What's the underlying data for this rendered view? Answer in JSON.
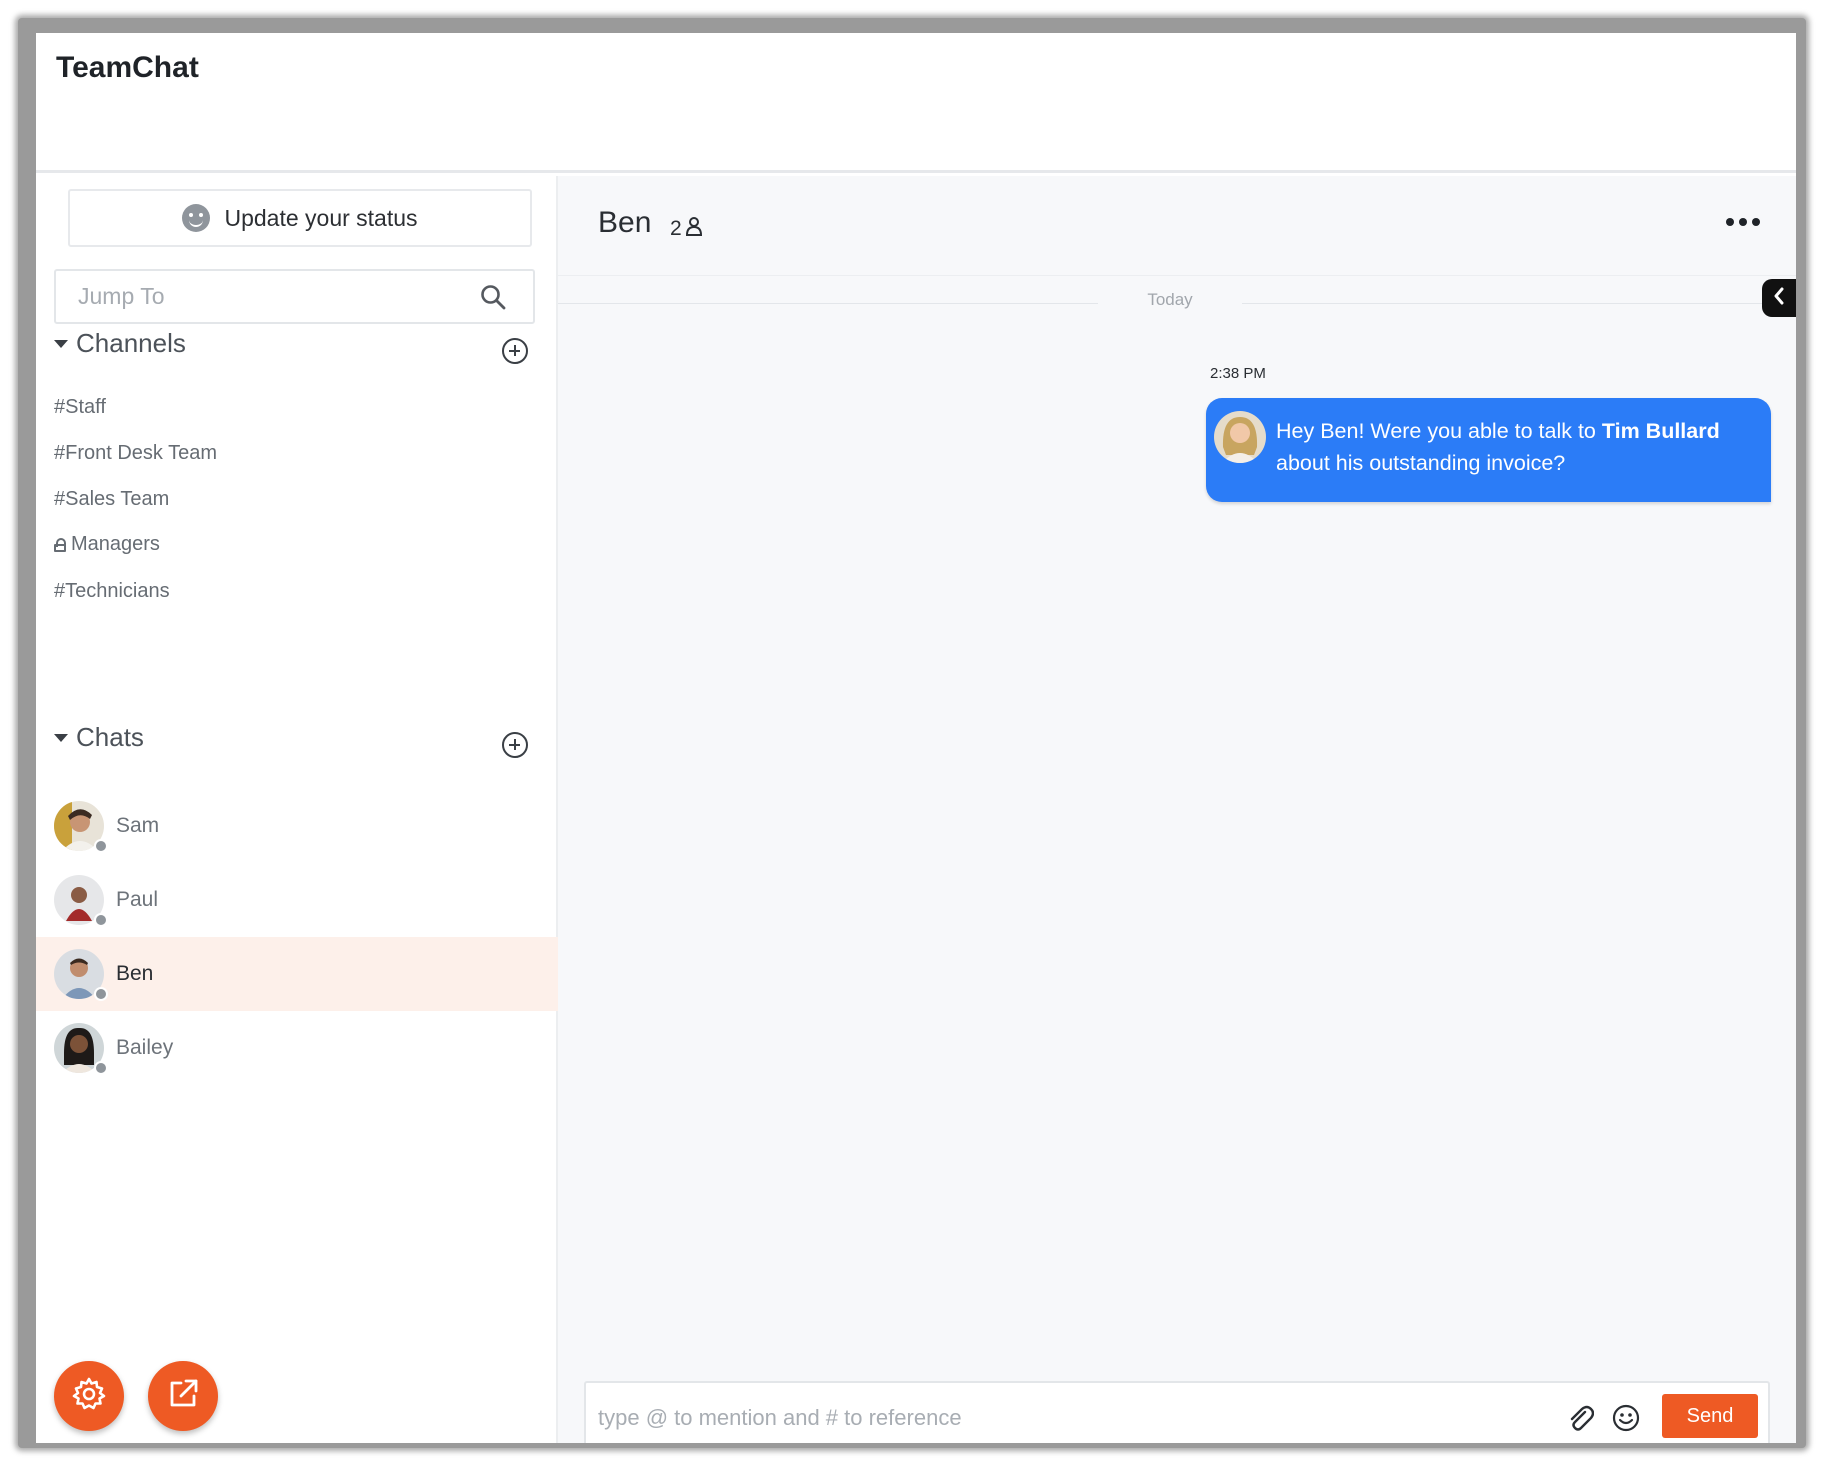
{
  "app": {
    "title": "TeamChat"
  },
  "status": {
    "label": "Update your status"
  },
  "jump": {
    "placeholder": "Jump To"
  },
  "channels": {
    "header": "Channels",
    "items": [
      {
        "label": "#Staff",
        "private": false
      },
      {
        "label": "#Front Desk Team",
        "private": false
      },
      {
        "label": "#Sales Team",
        "private": false
      },
      {
        "label": "Managers",
        "private": true
      },
      {
        "label": "#Technicians",
        "private": false
      }
    ]
  },
  "chats": {
    "header": "Chats",
    "items": [
      {
        "name": "Sam",
        "active": false
      },
      {
        "name": "Paul",
        "active": false
      },
      {
        "name": "Ben",
        "active": true
      },
      {
        "name": "Bailey",
        "active": false
      }
    ]
  },
  "conversation": {
    "title": "Ben",
    "member_count": "2",
    "date_divider": "Today",
    "messages": [
      {
        "time": "2:38 PM",
        "text_before": "Hey Ben! Were you able to talk to ",
        "mention": "Tim Bullard",
        "text_after": " about his outstanding invoice?"
      }
    ]
  },
  "composer": {
    "placeholder": "type @ to mention and # to reference",
    "send_label": "Send"
  },
  "colors": {
    "accent": "#ee5a24",
    "bubble": "#2b7cf7",
    "active_row": "#fdf0ea",
    "presence": "#8f959b"
  },
  "icons": {
    "settings": "gear-icon",
    "popout": "external-link-icon",
    "search": "search-icon",
    "more": "more-horizontal-icon",
    "attach": "paperclip-icon",
    "emoji": "smiley-icon",
    "collapse": "chevron-left-icon"
  }
}
